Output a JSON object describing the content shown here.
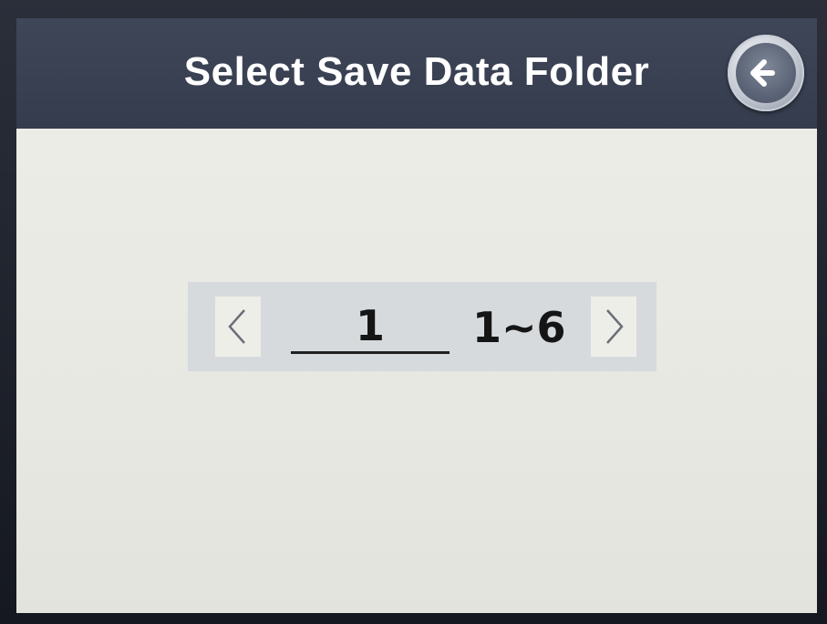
{
  "header": {
    "title": "Select Save Data Folder",
    "back_icon": "arrow-left-icon"
  },
  "folder_selector": {
    "value": "1",
    "range": "1~6",
    "prev_icon": "chevron-left-icon",
    "next_icon": "chevron-right-icon"
  },
  "colors": {
    "header_bg": "#3a4254",
    "screen_bg": "#e8e8e2",
    "stepper_bg": "#d6dadc",
    "text": "#151515"
  }
}
